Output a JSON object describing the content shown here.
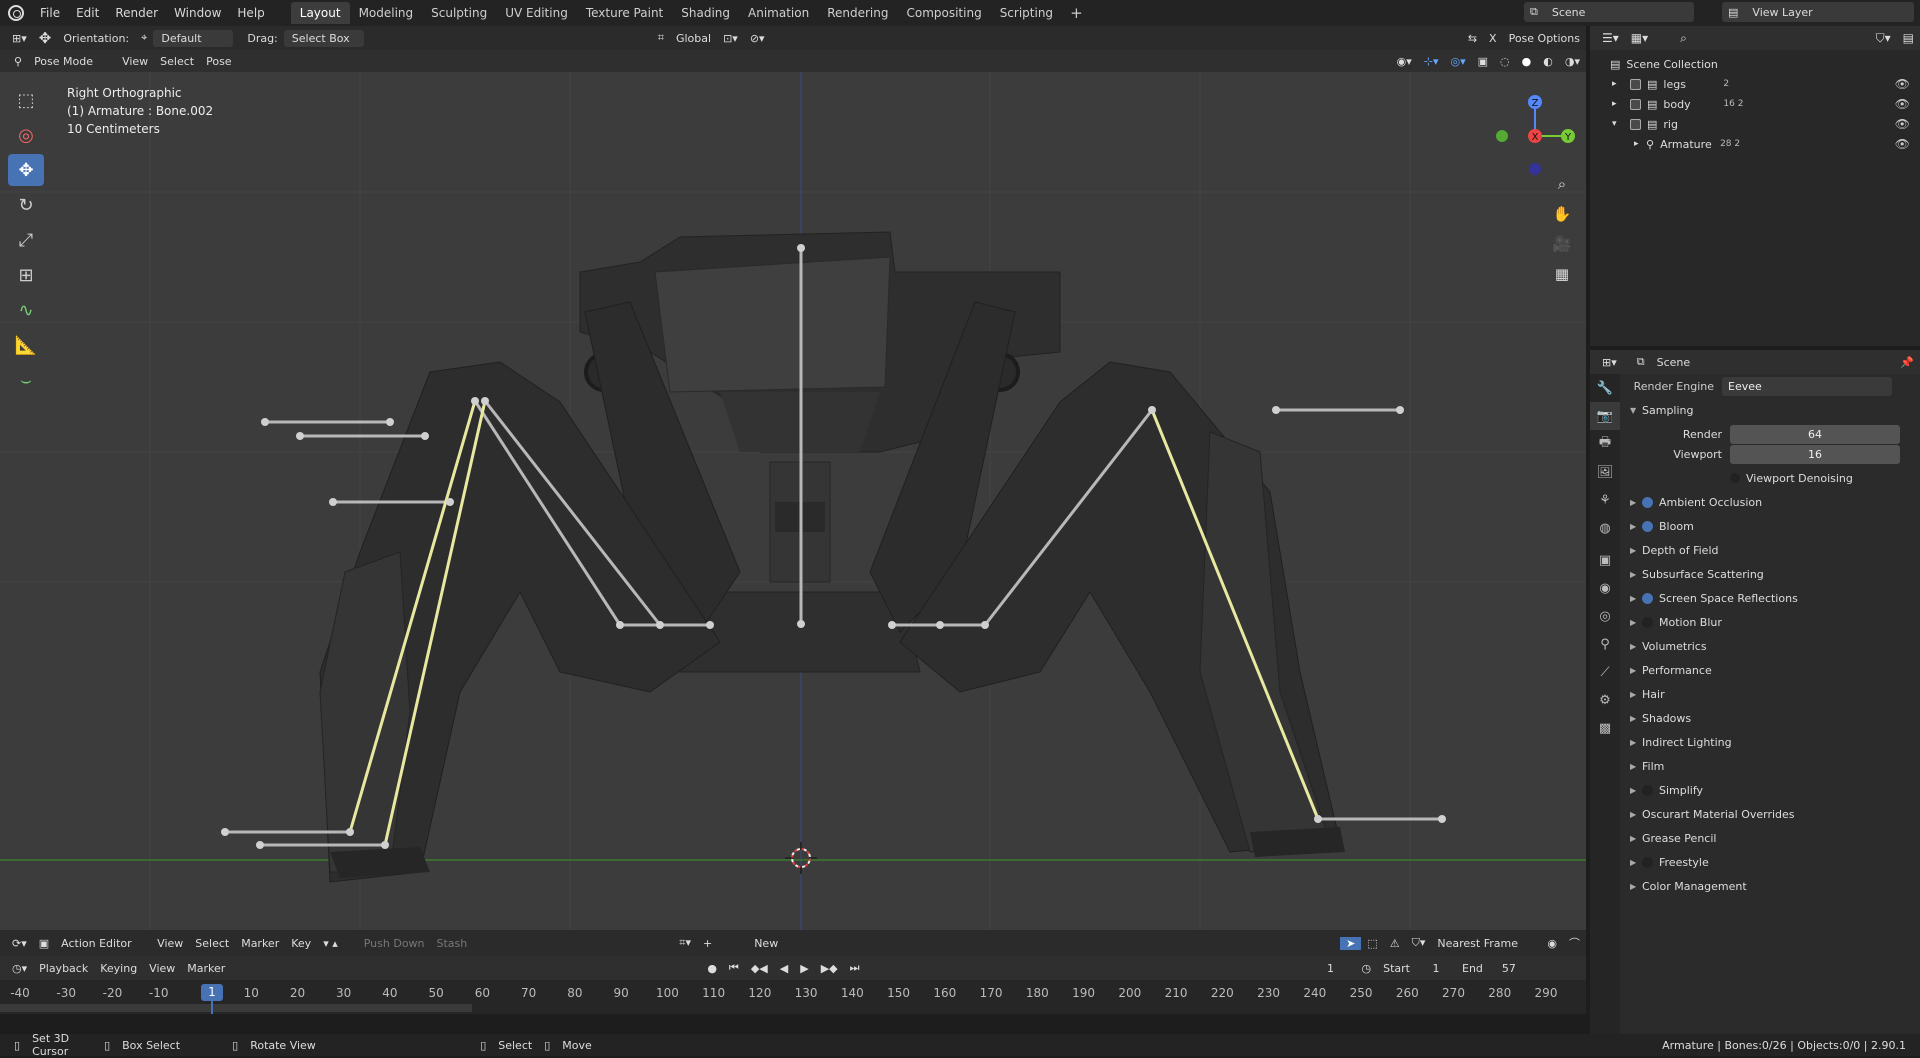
{
  "topbar": {
    "menu": [
      "File",
      "Edit",
      "Render",
      "Window",
      "Help"
    ],
    "workspaces": [
      "Layout",
      "Modeling",
      "Sculpting",
      "UV Editing",
      "Texture Paint",
      "Shading",
      "Animation",
      "Rendering",
      "Compositing",
      "Scripting"
    ],
    "active_workspace": "Layout",
    "scene": "Scene",
    "view_layer": "View Layer"
  },
  "viewport_header": {
    "orientation_label": "Orientation:",
    "orientation_value": "Default",
    "drag_label": "Drag:",
    "drag_value": "Select Box",
    "transform": "Global",
    "pose_options": "Pose Options",
    "x_label": "X"
  },
  "viewport_header2": {
    "mode": "Pose Mode",
    "menus": [
      "View",
      "Select",
      "Pose"
    ]
  },
  "viewport_info": {
    "view": "Right Orthographic",
    "object": "(1) Armature : Bone.002",
    "scale": "10 Centimeters"
  },
  "gizmo": {
    "z": "Z",
    "y": "Y",
    "x": "X"
  },
  "action_editor": {
    "editor": "Action Editor",
    "menus": [
      "View",
      "Select",
      "Marker",
      "Key"
    ],
    "push_down": "Push Down",
    "stash": "Stash",
    "new": "New",
    "snap": "Nearest Frame"
  },
  "timeline": {
    "menus": [
      "Playback",
      "Keying",
      "View",
      "Marker"
    ],
    "current_frame": "1",
    "start_label": "Start",
    "start": "1",
    "end_label": "End",
    "end": "57"
  },
  "ruler": {
    "ticks": [
      "-40",
      "-30",
      "-20",
      "-10",
      "1",
      "10",
      "20",
      "30",
      "40",
      "50",
      "60",
      "70",
      "80",
      "90",
      "100",
      "110",
      "120",
      "130",
      "140",
      "150",
      "160",
      "170",
      "180",
      "190",
      "200",
      "210",
      "220",
      "230",
      "240",
      "250",
      "260",
      "270",
      "280",
      "290"
    ],
    "current": "1"
  },
  "status": {
    "left": [
      "Set 3D Cursor",
      "Box Select",
      "Rotate View",
      "Select",
      "Move"
    ],
    "right": "Armature | Bones:0/26 | Objects:0/0 | 2.90.1"
  },
  "outliner": {
    "root": "Scene Collection",
    "items": [
      {
        "name": "legs",
        "badge": "2"
      },
      {
        "name": "body",
        "badge": "16 2"
      },
      {
        "name": "rig",
        "badge": ""
      },
      {
        "name": "Armature",
        "badge": "28 2"
      }
    ]
  },
  "properties": {
    "scene": "Scene",
    "render_engine_label": "Render Engine",
    "render_engine": "Eevee",
    "sampling": "Sampling",
    "render_label": "Render",
    "render_value": "64",
    "viewport_label": "Viewport",
    "viewport_value": "16",
    "denoise": "Viewport Denoising",
    "panels": [
      {
        "name": "Ambient Occlusion",
        "dot": "#4772b3"
      },
      {
        "name": "Bloom",
        "dot": "#4772b3"
      },
      {
        "name": "Depth of Field",
        "dot": ""
      },
      {
        "name": "Subsurface Scattering",
        "dot": ""
      },
      {
        "name": "Screen Space Reflections",
        "dot": "#4772b3"
      },
      {
        "name": "Motion Blur",
        "dot": "#222"
      },
      {
        "name": "Volumetrics",
        "dot": ""
      },
      {
        "name": "Performance",
        "dot": ""
      },
      {
        "name": "Hair",
        "dot": ""
      },
      {
        "name": "Shadows",
        "dot": ""
      },
      {
        "name": "Indirect Lighting",
        "dot": ""
      },
      {
        "name": "Film",
        "dot": ""
      },
      {
        "name": "Simplify",
        "dot": "#222"
      },
      {
        "name": "Oscurart Material Overrides",
        "dot": ""
      },
      {
        "name": "Grease Pencil",
        "dot": ""
      },
      {
        "name": "Freestyle",
        "dot": "#222"
      },
      {
        "name": "Color Management",
        "dot": ""
      }
    ]
  },
  "colors": {
    "accent": "#4772b3",
    "bone_selected": "#e8e8a0",
    "axis_x": "#e44",
    "axis_y": "#7c3",
    "axis_z": "#58f"
  }
}
